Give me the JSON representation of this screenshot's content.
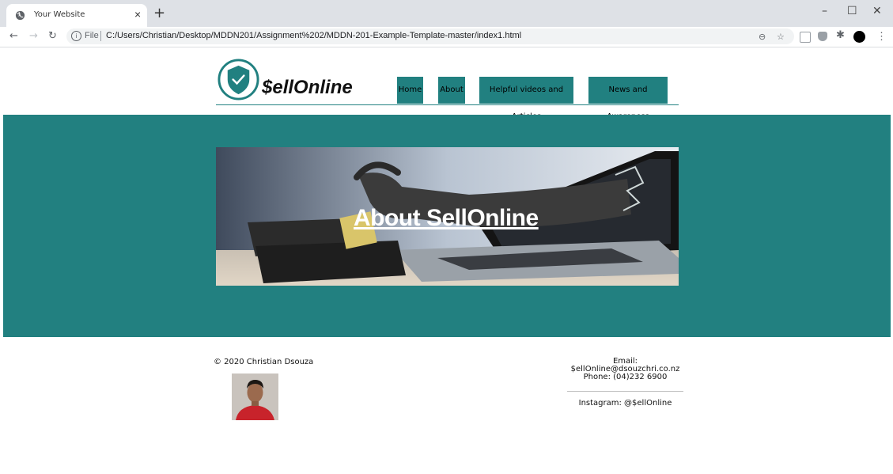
{
  "browser": {
    "tab_title": "Your Website",
    "tab_close": "×",
    "new_tab": "+",
    "url_scheme": "File",
    "url": "C:/Users/Christian/Desktop/MDDN201/Assignment%202/MDDN-201-Example-Template-master/index1.html",
    "window_controls": [
      "–",
      "☐",
      "✕"
    ],
    "icons": [
      "globe-icon",
      "back-icon",
      "forward-icon",
      "reload-icon",
      "info-icon",
      "zoom-icon",
      "star-icon",
      "extension-icon",
      "puzzle-icon",
      "profile-icon",
      "menu-icon"
    ]
  },
  "site": {
    "logo_text": "$ellOnline",
    "nav": [
      "Home",
      "About",
      "Helpful videos and Articles",
      "News and Awareness"
    ],
    "hero_title": "About SellOnline",
    "footer": {
      "copyright": "© 2020 Christian Dsouza",
      "email": "Email: $ellOnline@dsouzchri.co.nz",
      "phone": "Phone: (04)232 6900",
      "instagram": "Instagram: @$ellOnline"
    },
    "colors": {
      "teal": "#228080",
      "tab_bg": "#dee1e6"
    }
  }
}
